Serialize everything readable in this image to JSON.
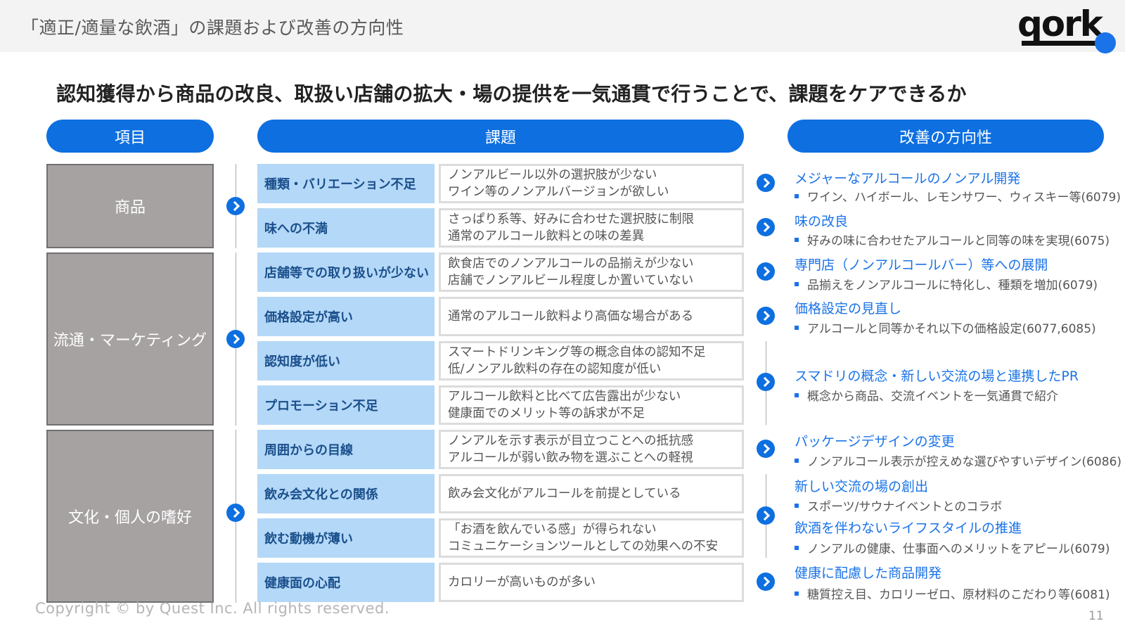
{
  "slide_title": "「適正/適量な飲酒」の課題および改善の方向性",
  "logo_text": "qork",
  "headline": "認知獲得から商品の改良、取扱い店舗の拡大・場の提供を一気通貫で行うことで、課題をケアできるか",
  "headers": {
    "item": "項目",
    "issue": "課題",
    "direction": "改善の方向性"
  },
  "categories": [
    "商品",
    "流通・マーケティング",
    "文化・個人の嗜好"
  ],
  "issues": [
    {
      "label": "種類・バリエーション不足",
      "desc": [
        "ノンアルビール以外の選択肢が少ない",
        "ワイン等のノンアルバージョンが欲しい"
      ]
    },
    {
      "label": "味への不満",
      "desc": [
        "さっぱり系等、好みに合わせた選択肢に制限",
        "通常のアルコール飲料との味の差異"
      ]
    },
    {
      "label": "店舗等での取り扱いが少ない",
      "desc": [
        "飲食店でのノンアルコールの品揃えが少ない",
        "店舗でノンアルビール程度しか置いていない"
      ]
    },
    {
      "label": "価格設定が高い",
      "desc": [
        "通常のアルコール飲料より高価な場合がある"
      ]
    },
    {
      "label": "認知度が低い",
      "desc": [
        "スマートドリンキング等の概念自体の認知不足",
        "低/ノンアル飲料の存在の認知度が低い"
      ]
    },
    {
      "label": "プロモーション不足",
      "desc": [
        "アルコール飲料と比べて広告露出が少ない",
        "健康面でのメリット等の訴求が不足"
      ]
    },
    {
      "label": "周囲からの目線",
      "desc": [
        "ノンアルを示す表示が目立つことへの抵抗感",
        "アルコールが弱い飲み物を選ぶことへの軽視"
      ]
    },
    {
      "label": "飲み会文化との関係",
      "desc": [
        "飲み会文化がアルコールを前提としている"
      ]
    },
    {
      "label": "飲む動機が薄い",
      "desc": [
        "「お酒を飲んでいる感」が得られない",
        "コミュニケーションツールとしての効果への不安"
      ]
    },
    {
      "label": "健康面の心配",
      "desc": [
        "カロリーが高いものが多い"
      ]
    }
  ],
  "directions": [
    {
      "title": "メジャーなアルコールのノンアル開発",
      "bullet": "ワイン、ハイボール、レモンサワー、ウィスキー等(6079)"
    },
    {
      "title": "味の改良",
      "bullet": "好みの味に合わせたアルコールと同等の味を実現(6075)"
    },
    {
      "title": "専門店（ノンアルコールバー）等への展開",
      "bullet": "品揃えをノンアルコールに特化し、種類を増加(6079)"
    },
    {
      "title": "価格設定の見直し",
      "bullet": "アルコールと同等かそれ以下の価格設定(6077,6085)"
    },
    {
      "title": "スマドリの概念・新しい交流の場と連携したPR",
      "bullet": "概念から商品、交流イベントを一気通貫で紹介"
    },
    {
      "title": "パッケージデザインの変更",
      "bullet": "ノンアルコール表示が控えめな選びやすいデザイン(6086)"
    },
    {
      "title": "新しい交流の場の創出",
      "bullet": "スポーツ/サウナイベントとのコラボ"
    },
    {
      "title": "飲酒を伴わないライフスタイルの推進",
      "bullet": "ノンアルの健康、仕事面へのメリットをアピール(6079)"
    },
    {
      "title": "健康に配慮した商品開発",
      "bullet": "糖質控え目、カロリーゼロ、原材料のこだわり等(6081)"
    }
  ],
  "colors": {
    "accent": "#0d6fe0",
    "issue_label_bg": "#b4d8f7",
    "category_bg": "#a6a2a2"
  },
  "copyright": "Copyright © by Quest Inc. All rights reserved.",
  "page_number": "11"
}
